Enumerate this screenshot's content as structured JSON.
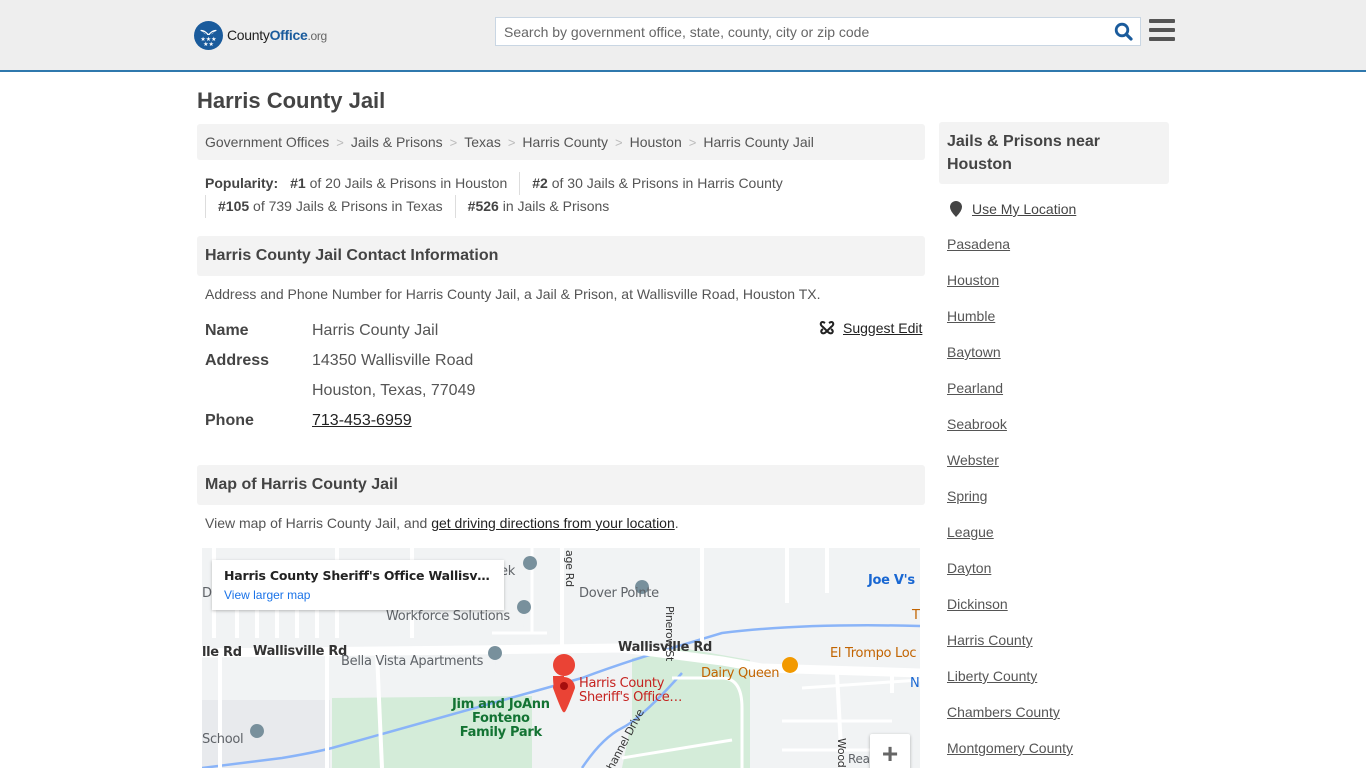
{
  "header": {
    "logo": {
      "name": "County",
      "office": "Office",
      "tld": ".org"
    },
    "search_placeholder": "Search by government office, state, county, city or zip code",
    "search_icon": "search-icon",
    "menu_icon": "hamburger-menu-icon",
    "accent_color": "#2f78ad",
    "brand_color": "#1a5b9c"
  },
  "page_title": "Harris County Jail",
  "breadcrumb": [
    "Government Offices",
    "Jails & Prisons",
    "Texas",
    "Harris County",
    "Houston",
    "Harris County Jail"
  ],
  "popularity": {
    "label": "Popularity:",
    "items": [
      {
        "rank": "#1",
        "text": " of 20 Jails & Prisons in Houston"
      },
      {
        "rank": "#2",
        "text": " of 30 Jails & Prisons in Harris County"
      },
      {
        "rank": "#105",
        "text": " of 739 Jails & Prisons in Texas"
      },
      {
        "rank": "#526",
        "text": " in Jails & Prisons"
      }
    ]
  },
  "contact": {
    "heading": "Harris County Jail Contact Information",
    "description": "Address and Phone Number for Harris County Jail, a Jail & Prison, at Wallisville Road, Houston TX.",
    "suggest_edit": "Suggest Edit",
    "fields": {
      "name_label": "Name",
      "name_value": "Harris County Jail",
      "address_label": "Address",
      "address_line1": "14350 Wallisville Road",
      "address_line2": "Houston, Texas, 77049",
      "phone_label": "Phone",
      "phone_value": "713-453-6959"
    }
  },
  "map_section": {
    "heading": "Map of Harris County Jail",
    "desc_prefix": "View map of Harris County Jail, and ",
    "desc_link": "get driving directions from your location",
    "desc_suffix": ".",
    "card_title": "Harris County Sheriff's Office Wallisv…",
    "card_link": "View larger map",
    "labels": {
      "wallisville_left": "lle Rd",
      "wallisville_mid": "Wallisville Rd",
      "wallisville_right": "Wallisville Rd",
      "workforce": "Workforce Solutions",
      "bella_vista": "Bella Vista Apartments",
      "dover_pointe": "Dover Pointe",
      "park_line1": "Jim and JoAnn",
      "park_line2": "Fonteno",
      "park_line3": "Family Park",
      "school": "School",
      "sheriff_line1": "Harris County",
      "sheriff_line2": "Sheriff's Office…",
      "dairy_queen": "Dairy Queen",
      "el_trompo": "El Trompo Loc",
      "joe_v": "Joe V's S",
      "pinerow": "Pinerow St",
      "edge_rd": "age Rd",
      "channel": "hannel Drive",
      "wood": "Wood",
      "rea": "Rea",
      "ek": "ek",
      "de": "De",
      "t": "T",
      "n": "N"
    },
    "zoom_in": "+"
  },
  "sidebar": {
    "heading": "Jails & Prisons near Houston",
    "use_location": "Use My Location",
    "links": [
      "Pasadena",
      "Houston",
      "Humble",
      "Baytown",
      "Pearland",
      "Seabrook",
      "Webster",
      "Spring",
      "League",
      "Dayton",
      "Dickinson",
      "Harris County",
      "Liberty County",
      "Chambers County",
      "Montgomery County"
    ]
  }
}
